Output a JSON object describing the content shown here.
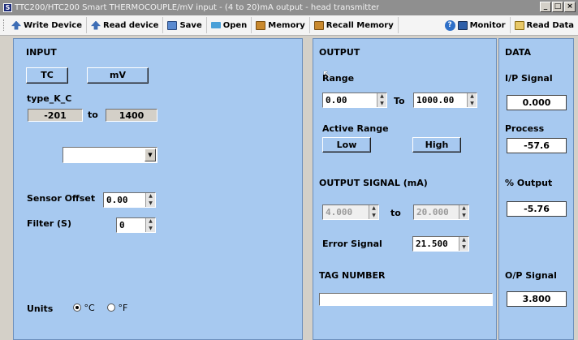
{
  "window": {
    "title": "TTC200/HTC200 Smart THERMOCOUPLE/mV input - (4 to 20)mA output - head transmitter",
    "buttons": [
      "_",
      "□",
      "×"
    ]
  },
  "toolbar": {
    "write_device": "Write Device",
    "read_device": "Read device",
    "save": "Save",
    "open": "Open",
    "memory": "Memory",
    "recall_memory": "Recall Memory",
    "monitor": "Monitor",
    "read_data": "Read Data"
  },
  "input": {
    "title": "INPUT",
    "tc_button": "TC",
    "mv_button": "mV",
    "type_label": "type_K_C",
    "range_low": "-201",
    "range_to": "to",
    "range_high": "1400",
    "dropdown_value": "",
    "sensor_offset_label": "Sensor Offset",
    "sensor_offset_value": "0.00",
    "filter_label": "Filter (S)",
    "filter_value": "0",
    "units_label": "Units",
    "unit_c": "°C",
    "unit_f": "°F",
    "unit_selected": "°C"
  },
  "output": {
    "title": "OUTPUT",
    "range_label": "Range",
    "range_low": "0.00",
    "range_to": "To",
    "range_high": "1000.00",
    "active_range_label": "Active Range",
    "low_button": "Low",
    "high_button": "High",
    "signal_label": "OUTPUT SIGNAL (mA)",
    "signal_low": "4.000",
    "signal_to": "to",
    "signal_high": "20.000",
    "error_signal_label": "Error Signal",
    "error_signal_value": "21.500",
    "tag_label": "TAG NUMBER",
    "tag_value": ""
  },
  "data": {
    "title": "DATA",
    "ip_signal_label": "I/P Signal",
    "ip_signal_value": "0.000",
    "process_label": "Process",
    "process_value": "-57.6",
    "percent_output_label": "% Output",
    "percent_output_value": "-5.76",
    "op_signal_label": "O/P Signal",
    "op_signal_value": "3.800"
  },
  "colors": {
    "panel_bg": "#a7c9f0",
    "window_bg": "#d4d0c8"
  }
}
